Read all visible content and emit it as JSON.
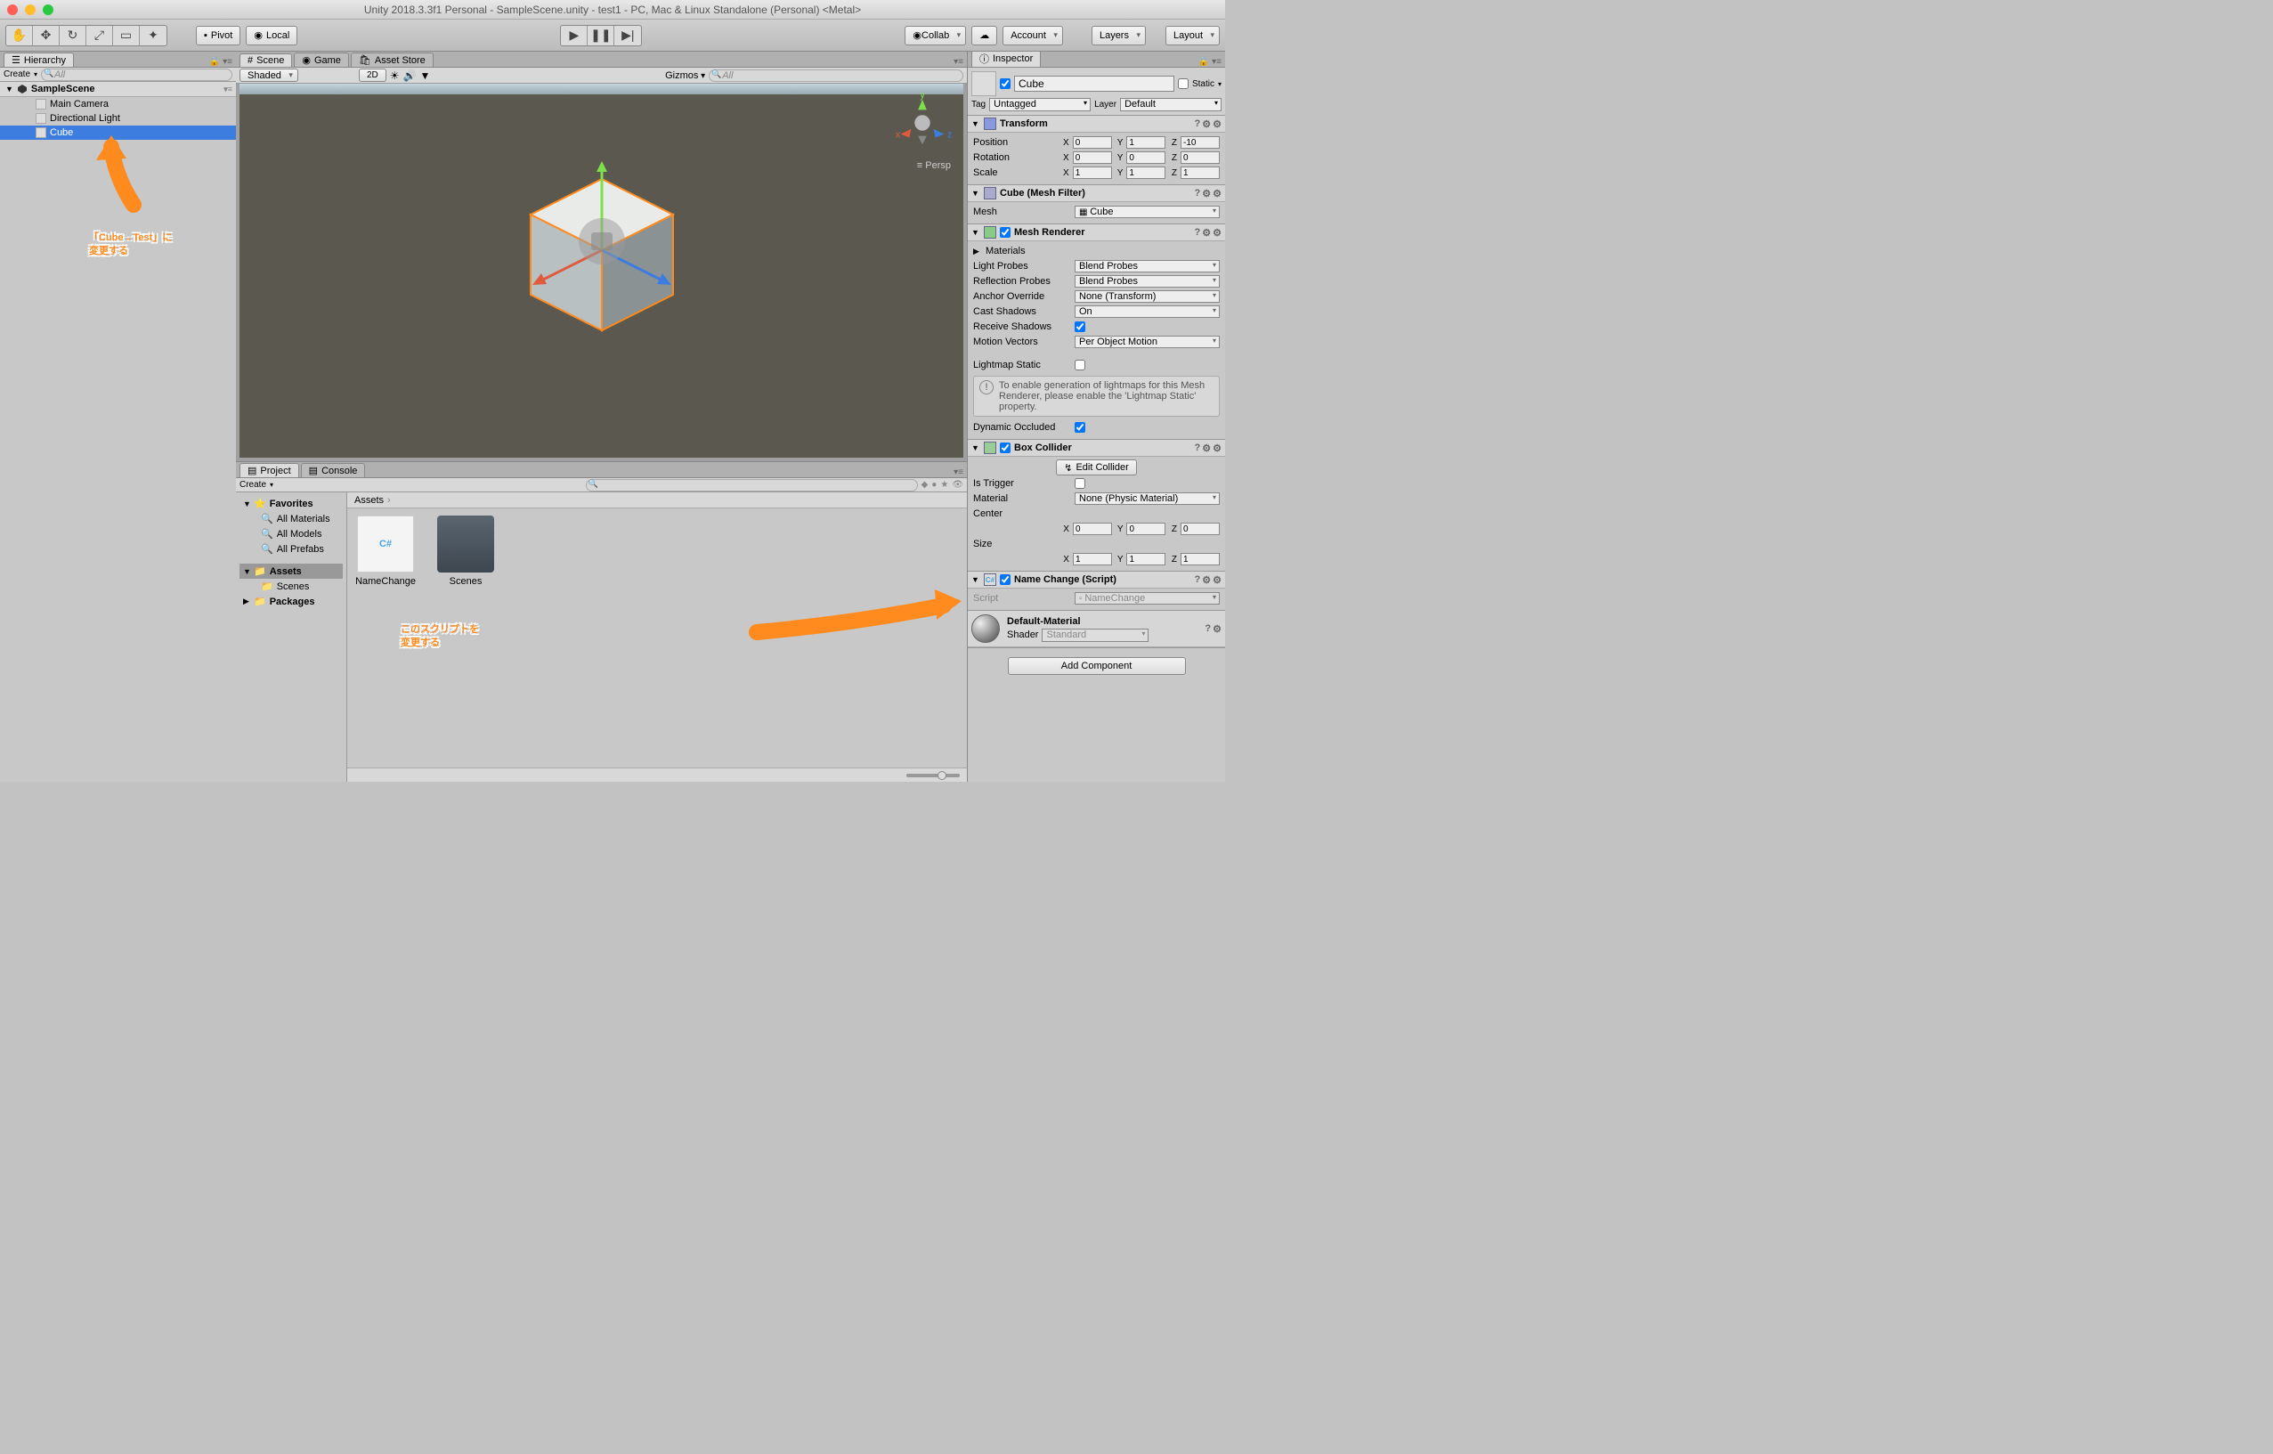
{
  "window": {
    "title": "Unity 2018.3.3f1 Personal - SampleScene.unity - test1 - PC, Mac & Linux Standalone (Personal) <Metal>"
  },
  "toolbar": {
    "pivot": "Pivot",
    "local": "Local",
    "collab": "Collab",
    "account": "Account",
    "layers": "Layers",
    "layout": "Layout"
  },
  "hierarchy": {
    "title": "Hierarchy",
    "create": "Create",
    "searchPlaceholder": "All",
    "scene": "SampleScene",
    "items": [
      "Main Camera",
      "Directional Light",
      "Cube"
    ]
  },
  "sceneTabs": {
    "scene": "Scene",
    "game": "Game",
    "asset": "Asset Store"
  },
  "sceneToolbar": {
    "shading": "Shaded",
    "twod": "2D",
    "gizmos": "Gizmos",
    "searchPlaceholder": "All"
  },
  "persp": "Persp",
  "project": {
    "title": "Project",
    "console": "Console",
    "create": "Create",
    "favorites": "Favorites",
    "favItems": [
      "All Materials",
      "All Models",
      "All Prefabs"
    ],
    "assets": "Assets",
    "assetItems": [
      "Scenes"
    ],
    "packages": "Packages",
    "breadcrumb": "Assets",
    "files": [
      {
        "name": "NameChange",
        "type": "file",
        "label": "C#"
      },
      {
        "name": "Scenes",
        "type": "folder"
      }
    ]
  },
  "inspector": {
    "title": "Inspector",
    "name": "Cube",
    "active": true,
    "static": "Static",
    "tag": "Tag",
    "tagValue": "Untagged",
    "layer": "Layer",
    "layerValue": "Default",
    "transform": {
      "title": "Transform",
      "position": "Position",
      "rotation": "Rotation",
      "scale": "Scale",
      "pos": [
        "0",
        "1",
        "-10"
      ],
      "rot": [
        "0",
        "0",
        "0"
      ],
      "scl": [
        "1",
        "1",
        "1"
      ]
    },
    "meshFilter": {
      "title": "Cube (Mesh Filter)",
      "mesh": "Mesh",
      "meshValue": "Cube"
    },
    "meshRenderer": {
      "title": "Mesh Renderer",
      "materials": "Materials",
      "lightProbes": "Light Probes",
      "lightProbesVal": "Blend Probes",
      "reflectionProbes": "Reflection Probes",
      "reflectionProbesVal": "Blend Probes",
      "anchorOverride": "Anchor Override",
      "anchorOverrideVal": "None (Transform)",
      "castShadows": "Cast Shadows",
      "castShadowsVal": "On",
      "receiveShadows": "Receive Shadows",
      "motionVectors": "Motion Vectors",
      "motionVectorsVal": "Per Object Motion",
      "lightmapStatic": "Lightmap Static",
      "lightmapMsg": "To enable generation of lightmaps for this Mesh Renderer, please enable the 'Lightmap Static' property.",
      "dynamicOccluded": "Dynamic Occluded"
    },
    "boxCollider": {
      "title": "Box Collider",
      "editCollider": "Edit Collider",
      "isTrigger": "Is Trigger",
      "material": "Material",
      "materialVal": "None (Physic Material)",
      "center": "Center",
      "centerVal": [
        "0",
        "0",
        "0"
      ],
      "size": "Size",
      "sizeVal": [
        "1",
        "1",
        "1"
      ]
    },
    "script": {
      "title": "Name Change (Script)",
      "scriptLbl": "Script",
      "scriptVal": "NameChange"
    },
    "material": {
      "title": "Default-Material",
      "shader": "Shader",
      "shaderVal": "Standard"
    },
    "addComponent": "Add Component"
  },
  "annotations": {
    "a1line1": "「Cube→Test」に",
    "a1line2": "変更する",
    "a2line1": "このスクリプトを",
    "a2line2": "変更する"
  }
}
